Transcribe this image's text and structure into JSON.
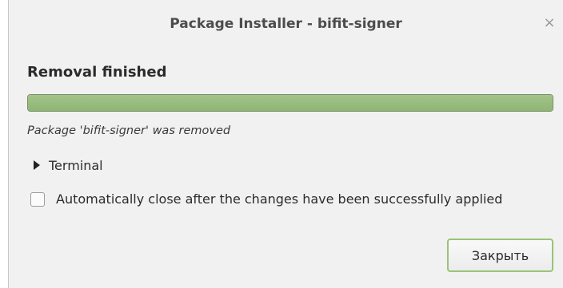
{
  "window": {
    "title": "Package Installer - bifit-signer",
    "close_glyph": "×"
  },
  "main": {
    "heading": "Removal finished",
    "progress": {
      "fraction": 1.0,
      "fill_color": "#95ba79"
    },
    "status_text": "Package 'bifit-signer' was removed",
    "expander": {
      "label": "Terminal",
      "icon": "triangle-right-icon",
      "expanded": false
    },
    "auto_close": {
      "label": "Automatically close after the changes have been successfully applied",
      "checked": false
    }
  },
  "footer": {
    "close_button_label": "Закрыть"
  },
  "colors": {
    "accent": "#9bc27a",
    "window_bg": "#f1f1f1"
  }
}
